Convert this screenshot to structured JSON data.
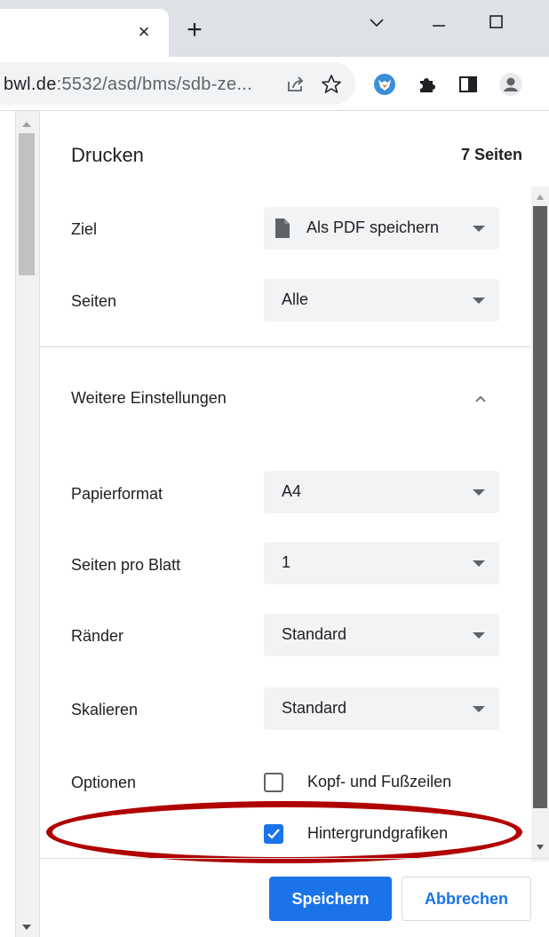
{
  "browser": {
    "url_host": "bwl.de",
    "url_path": ":5532/asd/bms/sdb-ze...",
    "tab_close_glyph": "×",
    "new_tab_glyph": "+",
    "colors": {
      "accent": "#1a73e8",
      "annotation": "#b00000"
    }
  },
  "dialog": {
    "title": "Drucken",
    "page_count": "7 Seiten",
    "destination": {
      "label": "Ziel",
      "value": "Als PDF speichern"
    },
    "pages": {
      "label": "Seiten",
      "value": "Alle"
    },
    "more_settings": "Weitere Einstellungen",
    "paper_size": {
      "label": "Papierformat",
      "value": "A4"
    },
    "pages_per_sheet": {
      "label": "Seiten pro Blatt",
      "value": "1"
    },
    "margins": {
      "label": "Ränder",
      "value": "Standard"
    },
    "scale": {
      "label": "Skalieren",
      "value": "Standard"
    },
    "options": {
      "label": "Optionen",
      "headers_footers": {
        "label": "Kopf- und Fußzeilen",
        "checked": false
      },
      "background_graphics": {
        "label": "Hintergrundgrafiken",
        "checked": true
      }
    },
    "save_button": "Speichern",
    "cancel_button": "Abbrechen"
  }
}
